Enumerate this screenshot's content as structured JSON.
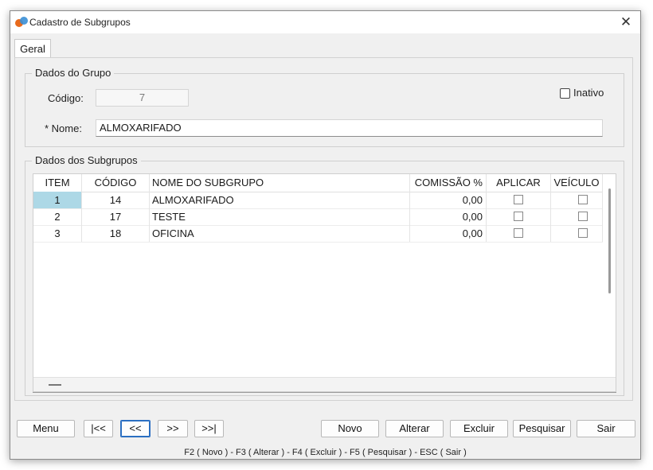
{
  "window": {
    "title": "Cadastro de Subgrupos",
    "close_symbol": "✕"
  },
  "tabs": [
    {
      "label": "Geral"
    }
  ],
  "dados_grupo": {
    "legend": "Dados do Grupo",
    "codigo_label": "Código:",
    "codigo_value": "7",
    "nome_label": "* Nome:",
    "nome_value": "ALMOXARIFADO",
    "inativo_label": "Inativo",
    "inativo_checked": false
  },
  "dados_subgrupos": {
    "legend": "Dados dos Subgrupos",
    "columns": [
      "ITEM",
      "CÓDIGO",
      "NOME DO SUBGRUPO",
      "COMISSÃO %",
      "APLICAR",
      "VEÍCULO"
    ],
    "rows": [
      {
        "item": "1",
        "codigo": "14",
        "nome": "ALMOXARIFADO",
        "comissao": "0,00",
        "aplicar": false,
        "veiculo": false
      },
      {
        "item": "2",
        "codigo": "17",
        "nome": "TESTE",
        "comissao": "0,00",
        "aplicar": false,
        "veiculo": false
      },
      {
        "item": "3",
        "codigo": "18",
        "nome": "OFICINA",
        "comissao": "0,00",
        "aplicar": false,
        "veiculo": false
      }
    ]
  },
  "buttons": {
    "menu": "Menu",
    "first": "|<<",
    "prev": "<<",
    "next": ">>",
    "last": ">>|",
    "novo": "Novo",
    "alterar": "Alterar",
    "excluir": "Excluir",
    "pesquisar": "Pesquisar",
    "sair": "Sair"
  },
  "status_bar": "F2 ( Novo )  -  F3 ( Alterar )  -  F4 ( Excluir )  -  F5 ( Pesquisar )  -  ESC ( Sair )",
  "colors": {
    "selection": "#add8e6",
    "focus_border": "#2b6fc2",
    "app_icon_orange": "#e86a1c",
    "app_icon_blue": "#3a8fd6"
  }
}
